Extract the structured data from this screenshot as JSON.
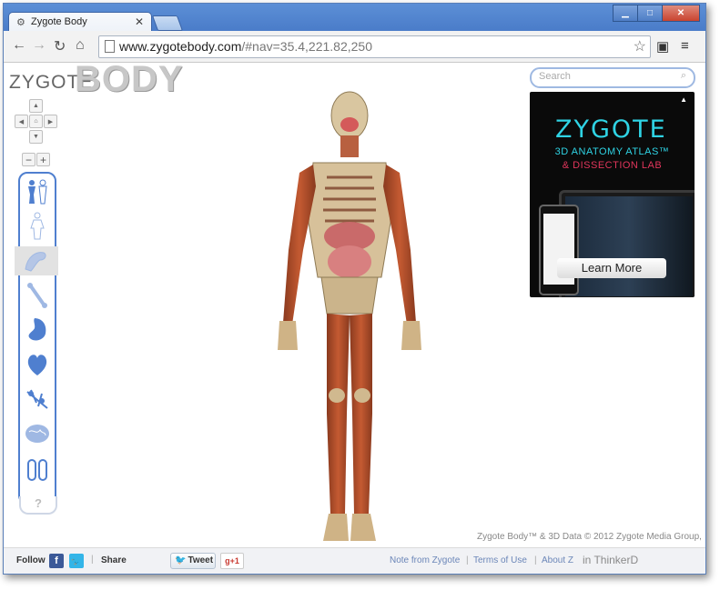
{
  "browser": {
    "tab_title": "Zygote Body",
    "tab_icon": "gear-icon",
    "close_tab": "✕",
    "win_min": "▁",
    "win_max": "□",
    "win_close": "✕",
    "url_domain": "www.zygotebody.com",
    "url_rest": "/#nav=35.4,221.82,250"
  },
  "site": {
    "logo_zygote": "ZYGOTE",
    "logo_body": "BODY",
    "search_placeholder": "Search",
    "copyright": "Zygote Body™ & 3D Data © 2012 Zygote Media Group,",
    "help_label": "?"
  },
  "layers": [
    {
      "name": "sex-toggle",
      "icon": "male-female-icon"
    },
    {
      "name": "skin",
      "icon": "skin-icon"
    },
    {
      "name": "muscle",
      "icon": "muscle-icon"
    },
    {
      "name": "skeleton",
      "icon": "bone-icon"
    },
    {
      "name": "organs",
      "icon": "stomach-icon"
    },
    {
      "name": "circulatory",
      "icon": "heart-icon"
    },
    {
      "name": "nervous",
      "icon": "nerve-icon"
    },
    {
      "name": "brain",
      "icon": "brain-icon"
    },
    {
      "name": "pills",
      "icon": "pills-icon"
    }
  ],
  "ad": {
    "brand": "ZYGOTE",
    "line1": "3D ANATOMY ATLAS™",
    "line2": "& DISSECTION LAB",
    "cta": "Learn More"
  },
  "footer": {
    "follow": "Follow",
    "share": "Share",
    "tweet": "Tweet",
    "gplus": "g+1",
    "links": [
      "Note from Zygote",
      "Terms of Use",
      "About Z"
    ],
    "watermark": "in ThinkerD"
  },
  "colors": {
    "accent": "#4f7fcf",
    "titlebar": "#5c8fd6",
    "ad_cyan": "#2fd3e4",
    "ad_red": "#e0355b"
  }
}
